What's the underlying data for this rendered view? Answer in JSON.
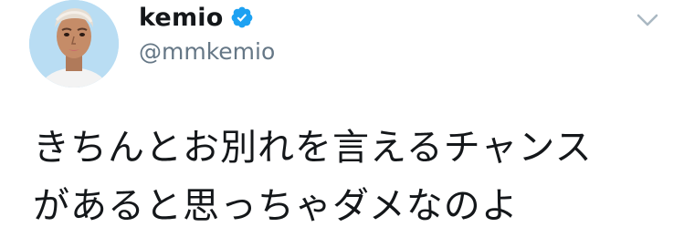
{
  "user": {
    "display_name": "kemio",
    "handle": "@mmkemio",
    "verified": true,
    "avatar_icon": "profile-avatar"
  },
  "tweet": {
    "lines": [
      "きちんとお別れを言えるチャンス",
      "があると思っちゃダメなのよ"
    ]
  },
  "menu": {
    "icon": "chevron-down-icon"
  },
  "colors": {
    "text": "#14171a",
    "secondary_text": "#657786",
    "verified_blue": "#1da1f2",
    "caret_gray": "#aab8c2"
  }
}
